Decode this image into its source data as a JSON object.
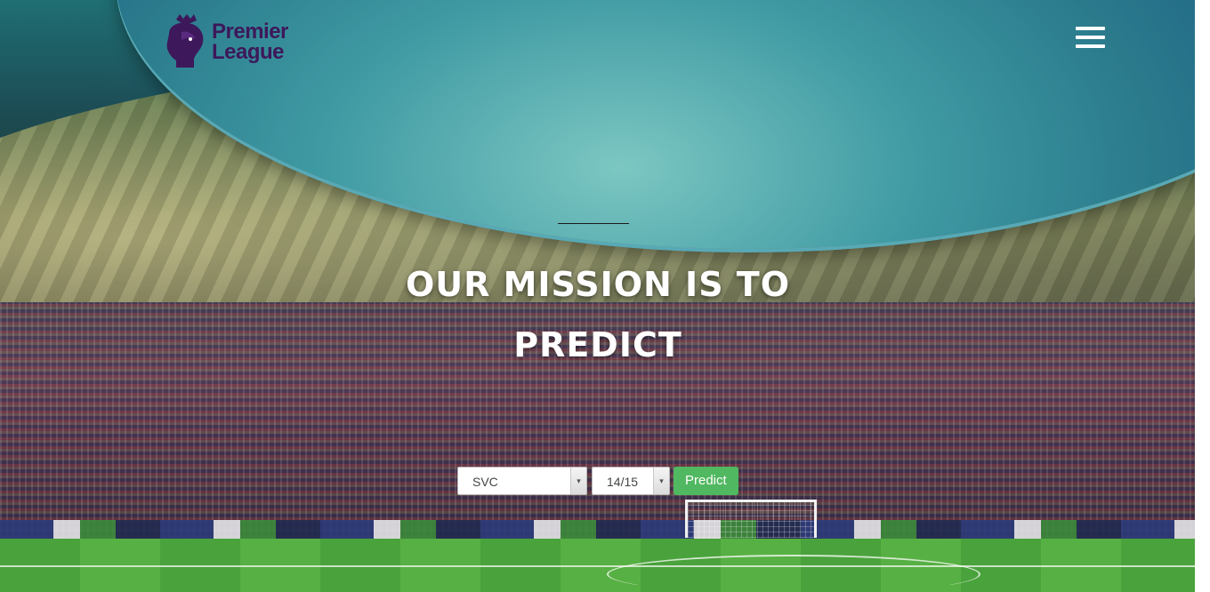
{
  "brand": {
    "logo_line1": "Premier",
    "logo_line2": "League",
    "logo_icon": "lion-crest-icon",
    "color": "#3d185a"
  },
  "nav": {
    "menu_icon": "hamburger-menu-icon"
  },
  "hero": {
    "headline_line1": "OUR MISSION IS TO",
    "headline_line2": "PREDICT"
  },
  "form": {
    "model_select_value": "SVC",
    "season_select_value": "14/15",
    "predict_label": "Predict",
    "predict_color": "#50b860"
  }
}
